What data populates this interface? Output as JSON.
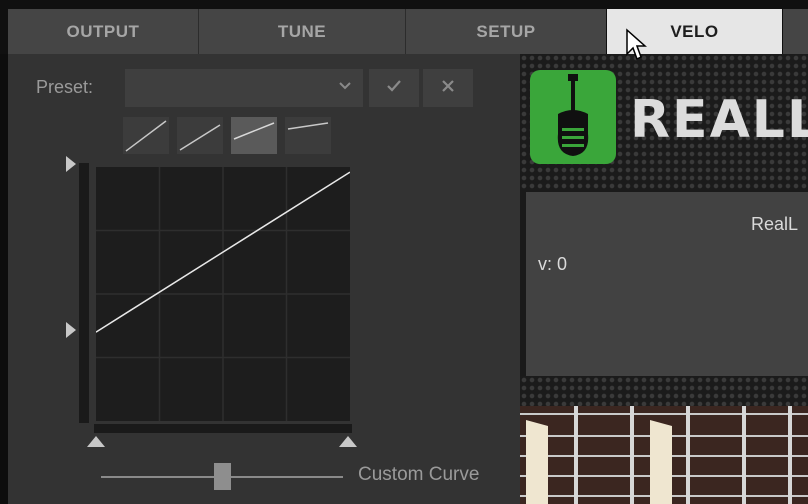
{
  "tabs": [
    {
      "label": "OUTPUT",
      "active": false
    },
    {
      "label": "TUNE",
      "active": false
    },
    {
      "label": "SETUP",
      "active": false
    },
    {
      "label": "VELO",
      "active": true
    }
  ],
  "preset": {
    "label": "Preset:",
    "value": "",
    "confirm_icon": "checkmark-icon",
    "clear_icon": "close-icon"
  },
  "curve_presets": [
    "curve-linear-steep-icon",
    "curve-linear-icon",
    "curve-gentle-icon",
    "curve-flat-icon"
  ],
  "curve_preset_selected": 2,
  "velocity_curve": {
    "start_level": 0.35,
    "end_level": 0.98
  },
  "curve_slider": {
    "label": "Custom Curve",
    "value": 0.5
  },
  "instrument_panel": {
    "brand": "REALLP",
    "title": "RealL",
    "velocity_readout": "v:  0"
  },
  "colors": {
    "active_tab": "#e6e6e6",
    "inactive_tab": "#454545",
    "panel_bg": "#333333",
    "logo_green": "#3aa63a"
  }
}
